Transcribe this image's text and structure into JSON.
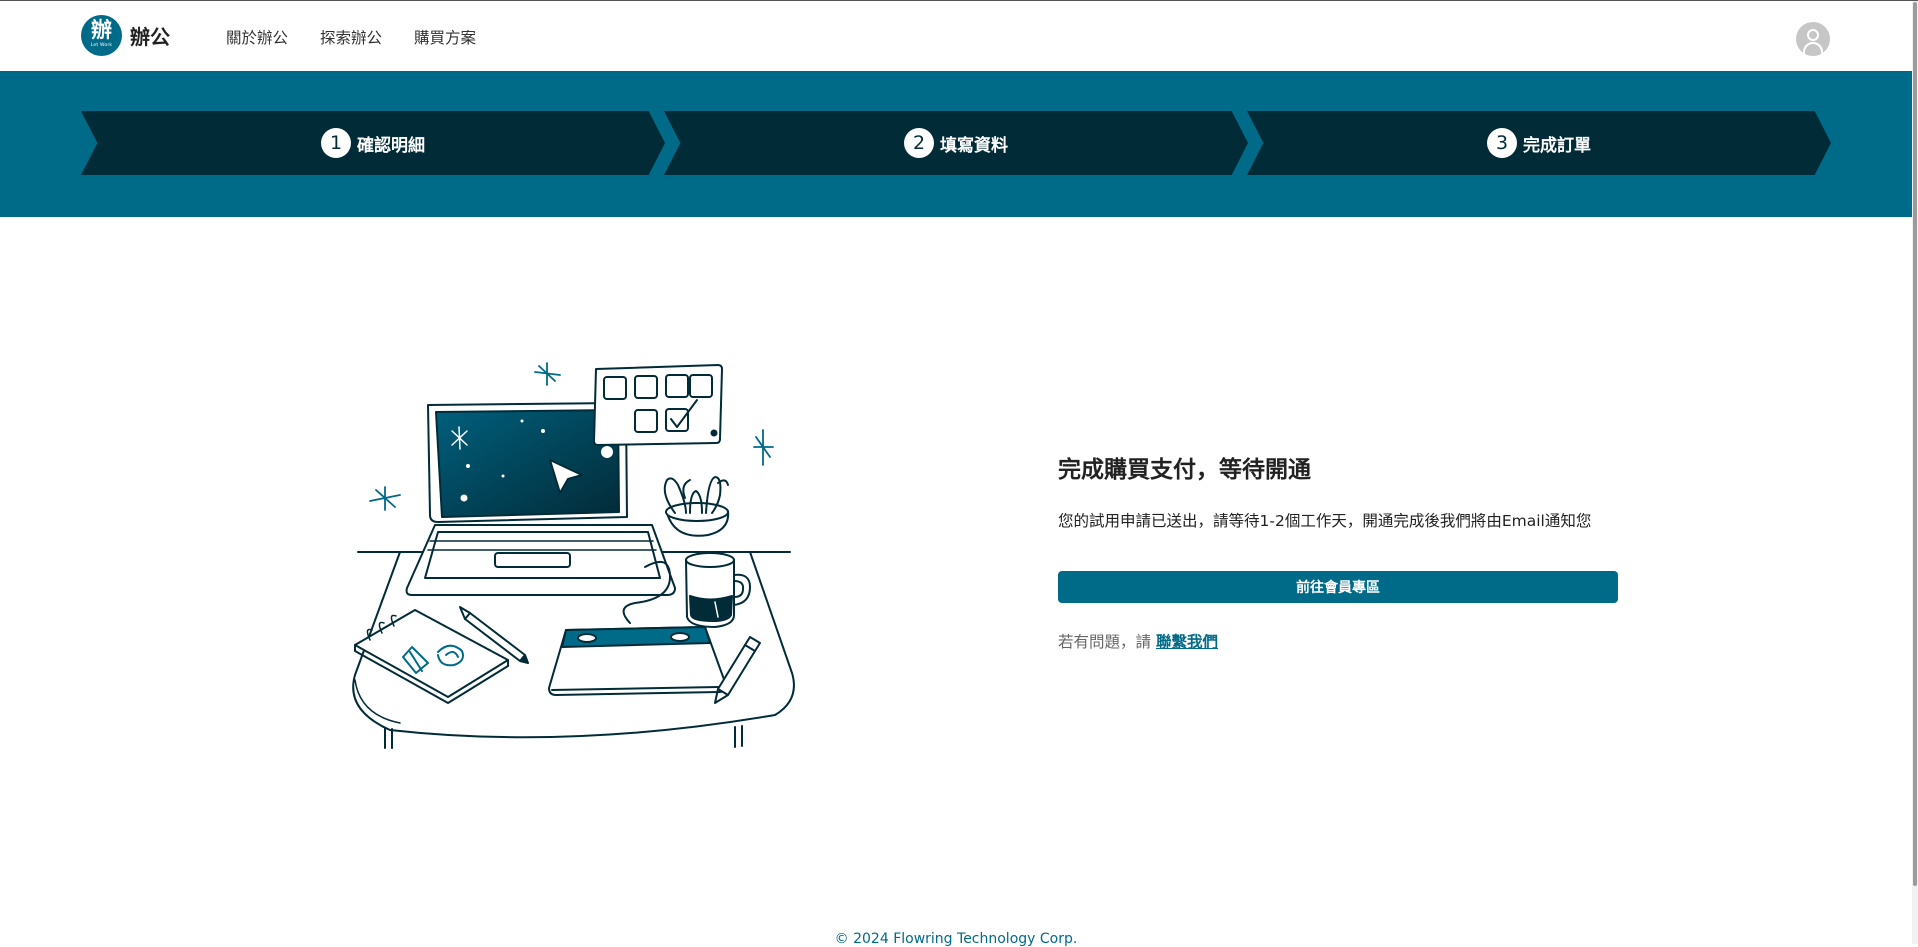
{
  "header": {
    "logo_char": "辦",
    "logo_sub": "Let Work",
    "logo_text": "辦公",
    "nav": [
      {
        "label": "關於辦公"
      },
      {
        "label": "探索辦公"
      },
      {
        "label": "購買方案"
      }
    ]
  },
  "steps": [
    {
      "number": "1",
      "label": "確認明細"
    },
    {
      "number": "2",
      "label": "填寫資料"
    },
    {
      "number": "3",
      "label": "完成訂單"
    }
  ],
  "main": {
    "title": "完成購買支付，等待開通",
    "description": "您的試用申請已送出，請等待1-2個工作天，開通完成後我們將由Email通知您",
    "cta_label": "前往會員專區",
    "help_prefix": "若有問題，請",
    "help_link": "聯繫我們"
  },
  "footer": {
    "copyright": "© 2024 Flowring Technology Corp."
  },
  "colors": {
    "brand": "#006a89",
    "step_bg": "#022b38"
  },
  "icons": [
    "user-avatar-icon",
    "desk-illustration"
  ]
}
